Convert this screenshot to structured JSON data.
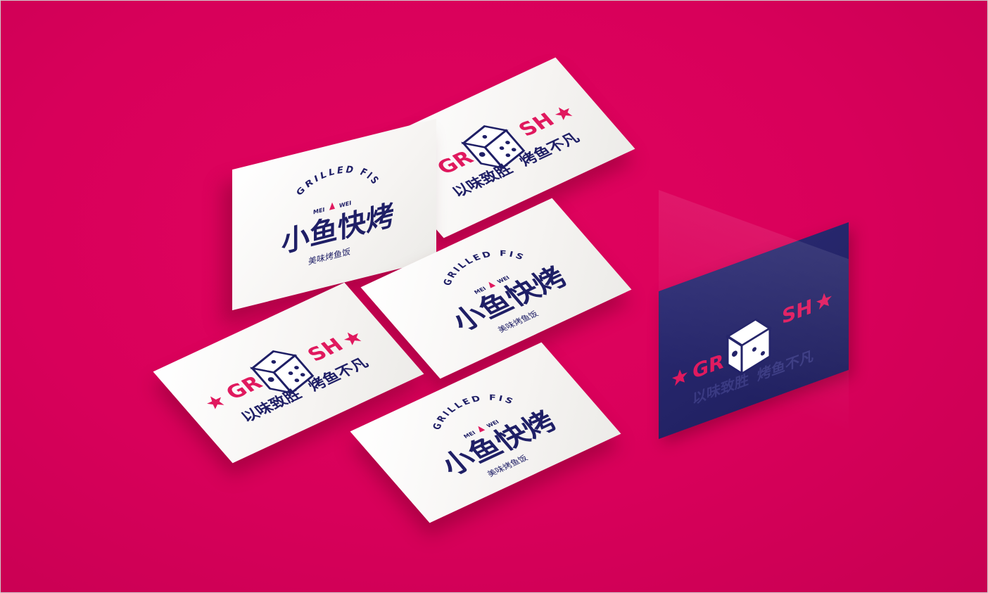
{
  "logo_card": {
    "arc_text": "GRILLED FISH",
    "sub_left": "MEI",
    "sub_right": "WEI",
    "title": "小鱼快烤",
    "tagline": "美味烤鱼饭",
    "flame_icon": "flame-icon"
  },
  "dice_card": {
    "brand_left": "GR",
    "brand_right": "SH",
    "slogan_left": "以味致胜",
    "slogan_right": "烤鱼不凡",
    "star_icon": "star-icon",
    "dice_icon": "dice-icon"
  },
  "colors": {
    "background": "#d8005a",
    "navy": "#1f1f66",
    "red": "#e0195e",
    "paper": "#ffffff"
  }
}
